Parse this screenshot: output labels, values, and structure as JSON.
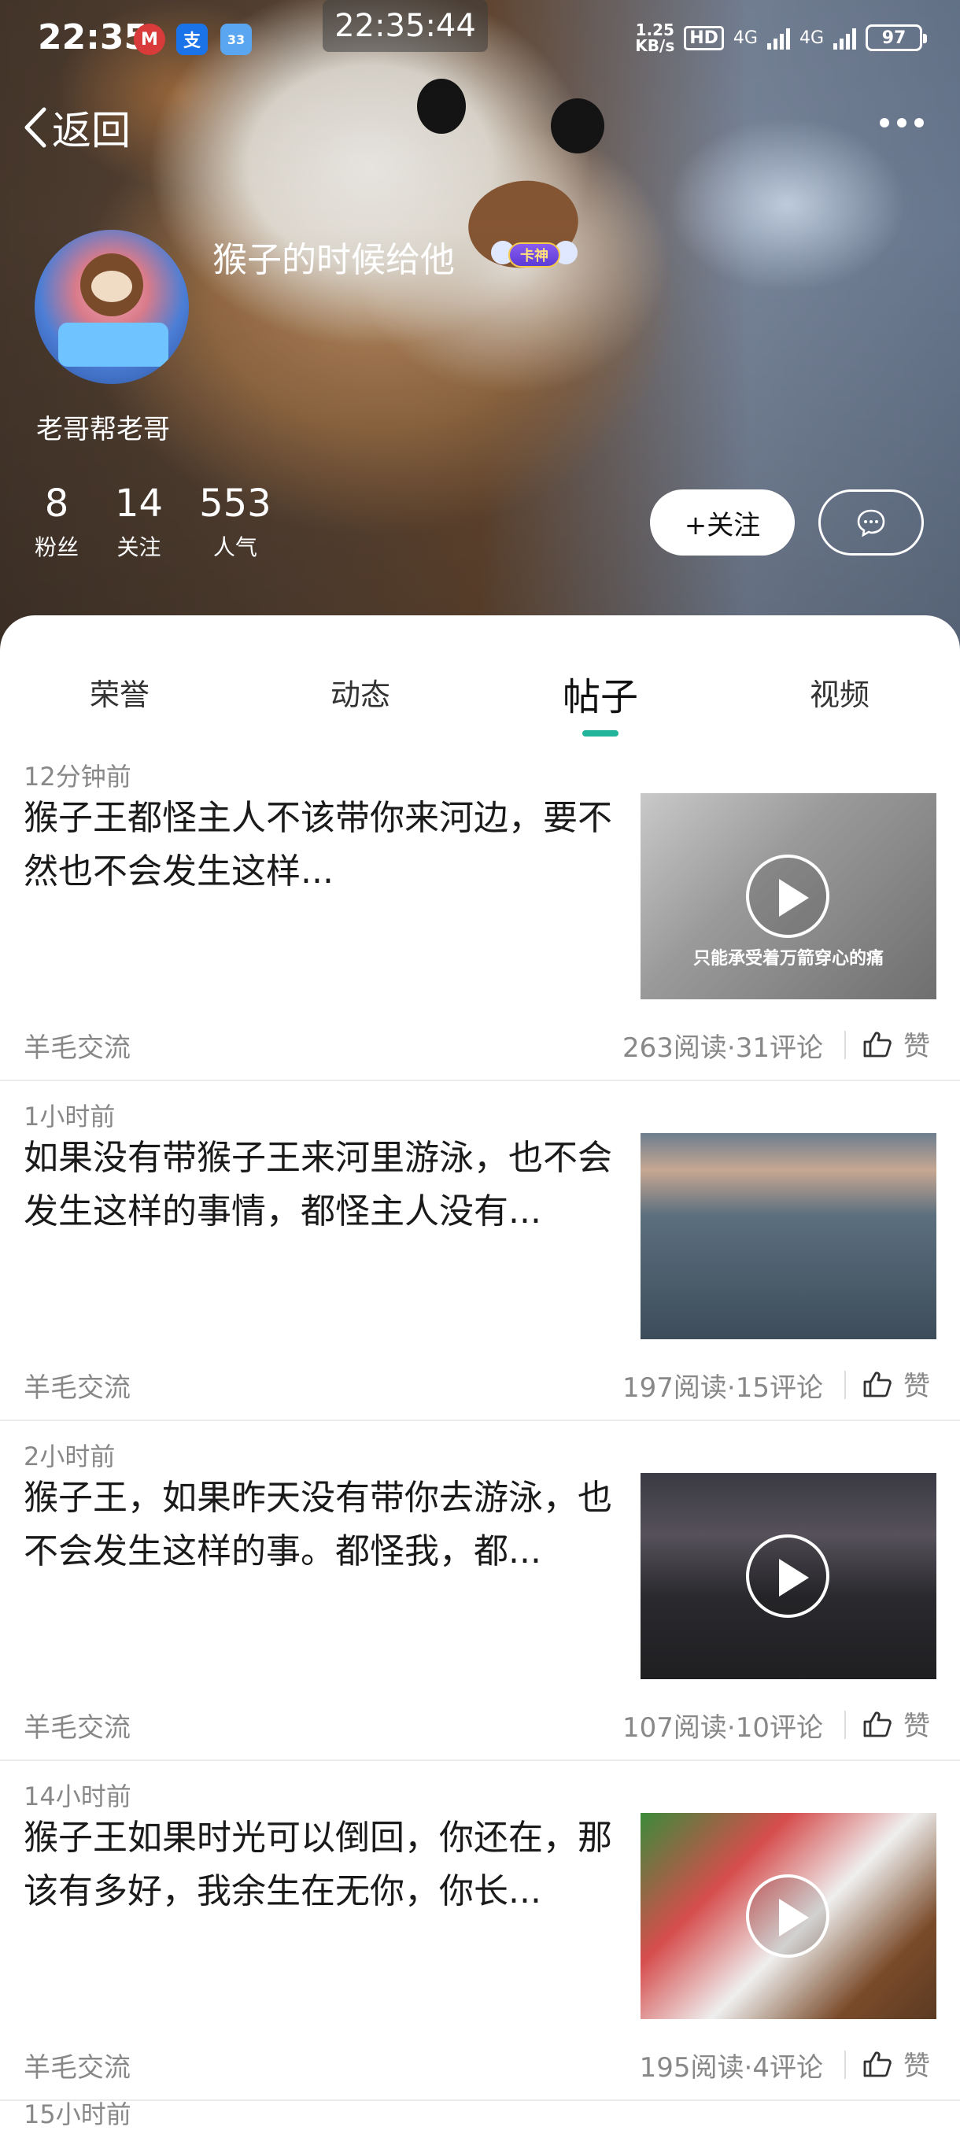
{
  "status_bar": {
    "time": "22:35",
    "clock": "22:35:44",
    "net_speed_top": "1.25",
    "net_speed_bottom": "KB/s",
    "hd_label": "HD",
    "signal1": "4G",
    "signal2": "4G",
    "battery": "97",
    "app_icons": [
      {
        "icon": "metro-app-icon",
        "color": "#d93a3a",
        "glyph": "M"
      },
      {
        "icon": "alipay-icon",
        "color": "#1a73e8",
        "glyph": "支"
      },
      {
        "icon": "weather-icon",
        "color": "#5aa6f0",
        "glyph": "33"
      }
    ]
  },
  "nav": {
    "back_label": "返回"
  },
  "profile": {
    "username": "猴子的时候给他",
    "badge_text": "卡神",
    "tagline": "老哥帮老哥",
    "stats": [
      {
        "value": "8",
        "label": "粉丝"
      },
      {
        "value": "14",
        "label": "关注"
      },
      {
        "value": "553",
        "label": "人气"
      }
    ],
    "follow_label": "+关注"
  },
  "tabs": [
    {
      "label": "荣誉"
    },
    {
      "label": "动态"
    },
    {
      "label": "帖子"
    },
    {
      "label": "视频"
    }
  ],
  "active_tab": "帖子",
  "posts": [
    {
      "time": "12分钟前",
      "title": "猴子王都怪主人不该带你来河边，要不然也不会发生这样...",
      "caption": "只能承受着万箭穿心的痛",
      "category": "羊毛交流",
      "meta": "263阅读·31评论",
      "like": "赞",
      "has_play": true
    },
    {
      "time": "1小时前",
      "title": "如果没有带猴子王来河里游泳，也不会发生这样的事情，都怪主人没有...",
      "caption": "",
      "category": "羊毛交流",
      "meta": "197阅读·15评论",
      "like": "赞",
      "has_play": false
    },
    {
      "time": "2小时前",
      "title": "猴子王，如果昨天没有带你去游泳，也不会发生这样的事。都怪我，都...",
      "caption": "",
      "category": "羊毛交流",
      "meta": "107阅读·10评论",
      "like": "赞",
      "has_play": true
    },
    {
      "time": "14小时前",
      "title": "猴子王如果时光可以倒回，你还在，那该有多好，我余生在无你，你长...",
      "caption": "",
      "category": "羊毛交流",
      "meta": "195阅读·4评论",
      "like": "赞",
      "has_play": true
    }
  ],
  "next_post_time": "15小时前",
  "colors": {
    "accent": "#23b59b",
    "muted_text": "#888888"
  }
}
